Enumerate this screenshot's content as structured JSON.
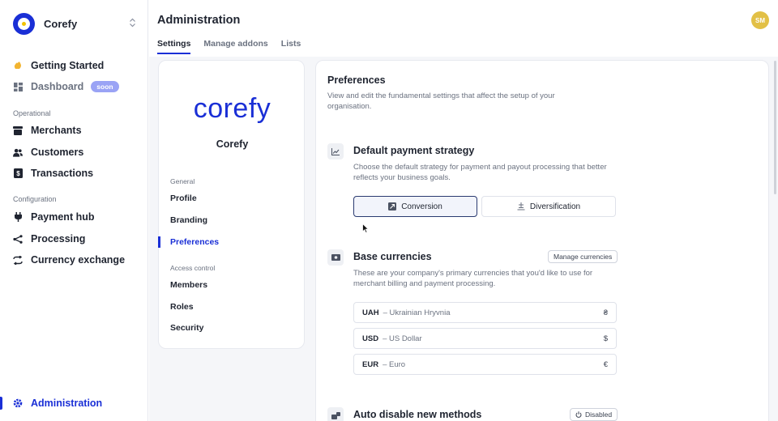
{
  "sidebar": {
    "brand": "Corefy",
    "items": [
      {
        "label": "Getting Started"
      },
      {
        "label": "Dashboard",
        "badge": "soon"
      }
    ],
    "sections": [
      {
        "title": "Operational",
        "items": [
          "Merchants",
          "Customers",
          "Transactions"
        ]
      },
      {
        "title": "Configuration",
        "items": [
          "Payment hub",
          "Processing",
          "Currency exchange"
        ]
      }
    ],
    "footer_item": "Administration"
  },
  "header": {
    "title": "Administration",
    "avatar_initials": "SM",
    "tabs": [
      "Settings",
      "Manage addons",
      "Lists"
    ],
    "active_tab": "Settings"
  },
  "org_card": {
    "wordmark": "corefy",
    "name": "Corefy",
    "sections": [
      {
        "title": "General",
        "items": [
          "Profile",
          "Branding",
          "Preferences"
        ]
      },
      {
        "title": "Access control",
        "items": [
          "Members",
          "Roles",
          "Security"
        ]
      }
    ],
    "active_item": "Preferences"
  },
  "preferences": {
    "title": "Preferences",
    "description": "View and edit the fundamental settings that affect the setup of your organisation.",
    "payment_strategy": {
      "title": "Default payment strategy",
      "description": "Choose the default strategy for payment and payout processing that better reflects your business goals.",
      "options": [
        "Conversion",
        "Diversification"
      ],
      "selected": "Conversion"
    },
    "base_currencies": {
      "title": "Base currencies",
      "manage_label": "Manage currencies",
      "description": "These are your company's primary currencies that you'd like to use for merchant billing and payment processing.",
      "currencies": [
        {
          "code": "UAH",
          "name": "– Ukrainian Hryvnia",
          "symbol": "₴"
        },
        {
          "code": "USD",
          "name": "– US Dollar",
          "symbol": "$"
        },
        {
          "code": "EUR",
          "name": "– Euro",
          "symbol": "€"
        }
      ]
    },
    "auto_disable": {
      "title": "Auto disable new methods",
      "status_label": "Disabled"
    }
  },
  "colors": {
    "accent": "#1a2fd6",
    "avatar": "#e2c046",
    "badge": "#9aa3f5"
  }
}
